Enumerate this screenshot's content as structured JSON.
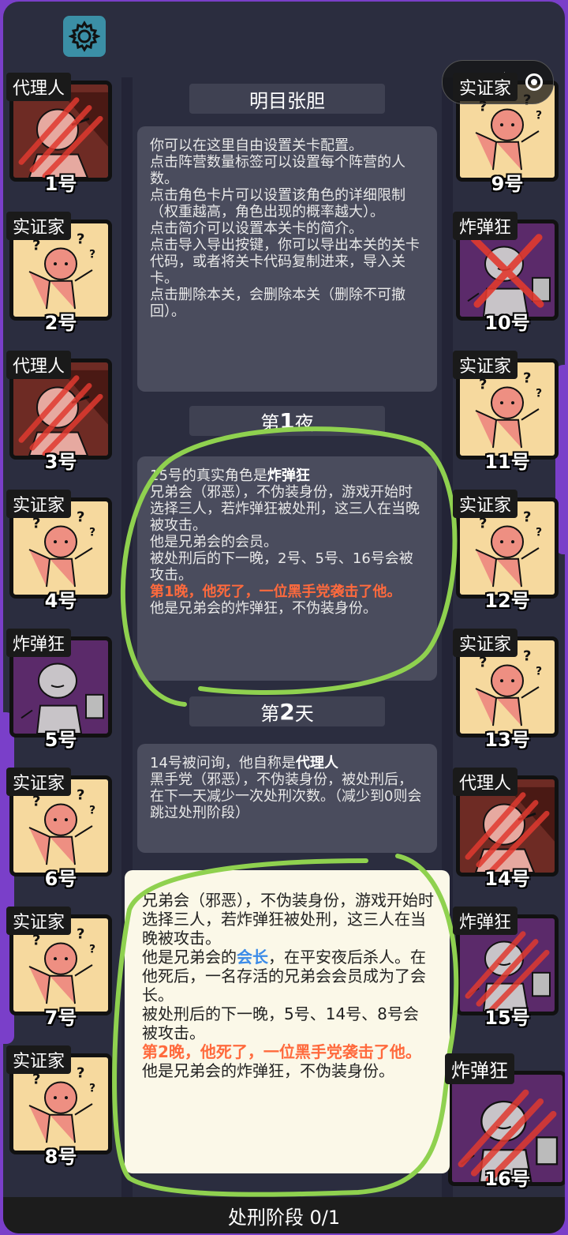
{
  "toolbar": {
    "settings_icon": "gear-icon"
  },
  "capsule": {
    "menu_icon": "more-dots-icon",
    "close_icon": "target-close-icon"
  },
  "level": {
    "title": "明目张胆"
  },
  "intro": {
    "lines": [
      "你可以在这里自由设置关卡配置。",
      "点击阵营数量标签可以设置每个阵营的人数。",
      "点击角色卡片可以设置该角色的详细限制（权重越高，角色出现的概率越大）。",
      "点击简介可以设置本关卡的简介。",
      "点击导入导出按键，你可以导出本关的关卡代码，或者将关卡代码复制进来，导入关卡。",
      "点击删除本关，会删除本关（删除不可撤回）。"
    ]
  },
  "night1": {
    "header_prefix": "第",
    "header_num": "1",
    "header_suffix": "夜",
    "line1_pre": "15号的真实角色是",
    "line1_role": "炸弹狂",
    "desc": "兄弟会（邪恶），不伪装身份，游戏开始时选择三人，若炸弹狂被处刑，这三人在当晚被攻击。",
    "member": "他是兄弟会的会员。",
    "attack": "被处刑后的下一晚，2号、5号、16号会被攻击。",
    "death": "第1晚，他死了，一位黑手党袭击了他。",
    "summary": "他是兄弟会的炸弹狂，不伪装身份。"
  },
  "day2": {
    "header_prefix": "第",
    "header_num": "2",
    "header_suffix": "天",
    "line1_pre": "14号被问询，他自称是",
    "line1_role": "代理人",
    "desc": "黑手党（邪恶），不伪装身份，被处刑后，在下一天减少一次处刑次数。（减少到0则会跳过处刑阶段）"
  },
  "popup": {
    "desc": "兄弟会（邪恶），不伪装身份，游戏开始时选择三人，若炸弹狂被处刑，这三人在当晚被攻击。",
    "leader_pre": "他是兄弟会的",
    "leader_role": "会长",
    "leader_post": "，在平安夜后杀人。在他死后，一名存活的兄弟会会员成为了会长。",
    "attack": "被处刑后的下一晚，5号、14号、8号会被攻击。",
    "death": "第2晚，他死了，一位黑手党袭击了他。",
    "summary": "他是兄弟会的炸弹狂，不伪装身份。"
  },
  "footer": {
    "label": "处刑阶段 0/1"
  },
  "players_left": [
    {
      "role": "代理人",
      "num": "1号",
      "type": "agent",
      "dead": true
    },
    {
      "role": "实证家",
      "num": "2号",
      "type": "empiric",
      "dead": false
    },
    {
      "role": "代理人",
      "num": "3号",
      "type": "agent",
      "dead": true
    },
    {
      "role": "实证家",
      "num": "4号",
      "type": "empiric",
      "dead": false
    },
    {
      "role": "炸弹狂",
      "num": "5号",
      "type": "bomber",
      "dead": false
    },
    {
      "role": "实证家",
      "num": "6号",
      "type": "empiric",
      "dead": false
    },
    {
      "role": "实证家",
      "num": "7号",
      "type": "empiric",
      "dead": false
    },
    {
      "role": "实证家",
      "num": "8号",
      "type": "empiric",
      "dead": false
    }
  ],
  "players_right": [
    {
      "role": "实证家",
      "num": "9号",
      "type": "empiric",
      "dead": false
    },
    {
      "role": "炸弹狂",
      "num": "10号",
      "type": "bomber",
      "dead": "x"
    },
    {
      "role": "实证家",
      "num": "11号",
      "type": "empiric",
      "dead": false
    },
    {
      "role": "实证家",
      "num": "12号",
      "type": "empiric",
      "dead": false
    },
    {
      "role": "实证家",
      "num": "13号",
      "type": "empiric",
      "dead": false
    },
    {
      "role": "代理人",
      "num": "14号",
      "type": "agent",
      "dead": true
    },
    {
      "role": "炸弹狂",
      "num": "15号",
      "type": "bomber",
      "dead": true
    },
    {
      "role": "炸弹狂",
      "num": "16号",
      "type": "bomber",
      "dead": true
    }
  ],
  "colors": {
    "empiric_bg": "#f6d99e",
    "agent_bg": "#6e2b24",
    "bomber_bg": "#5b2a6a",
    "highlight_red": "#ff6a3d",
    "highlight_blue": "#3b8be8",
    "scribble": "#8fd14f"
  }
}
